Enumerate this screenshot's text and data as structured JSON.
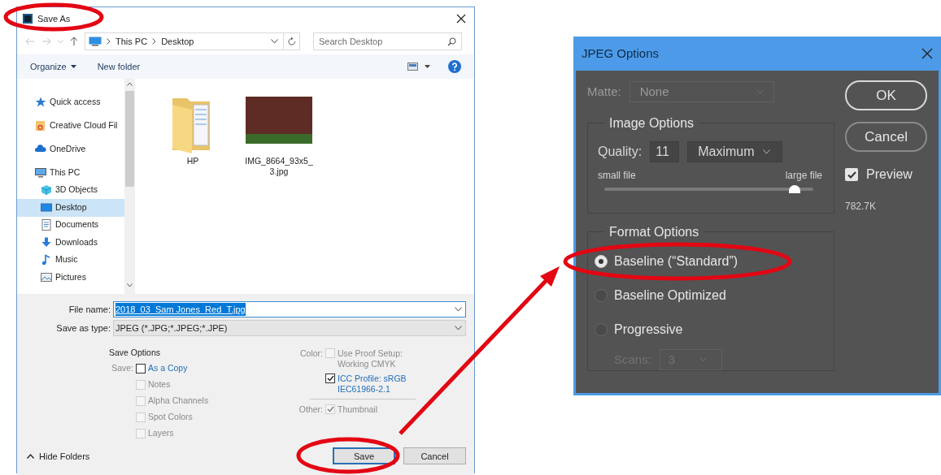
{
  "save_dialog": {
    "title": "Save As",
    "address": {
      "path": [
        "This PC",
        "Desktop"
      ]
    },
    "search": {
      "placeholder": "Search Desktop"
    },
    "toolbar": {
      "organize": "Organize",
      "new_folder": "New folder"
    },
    "sidebar": {
      "items": [
        {
          "label": "Quick access",
          "selected": false
        },
        {
          "label": "Creative Cloud Fil",
          "selected": false
        },
        {
          "label": "OneDrive",
          "selected": false
        },
        {
          "label": "This PC",
          "selected": false,
          "children": [
            {
              "label": "3D Objects",
              "selected": false
            },
            {
              "label": "Desktop",
              "selected": true
            },
            {
              "label": "Documents",
              "selected": false
            },
            {
              "label": "Downloads",
              "selected": false
            },
            {
              "label": "Music",
              "selected": false
            },
            {
              "label": "Pictures",
              "selected": false
            }
          ]
        }
      ]
    },
    "files": [
      {
        "kind": "folder",
        "name": "HP"
      },
      {
        "kind": "image",
        "name": "IMG_8664_93x5_3.jpg"
      }
    ],
    "file_name": {
      "label": "File name:",
      "value": "2018_03_Sam Jones_Red_T.jpg"
    },
    "save_as_type": {
      "label": "Save as type:",
      "value": "JPEG (*.JPG;*.JPEG;*.JPE)"
    },
    "save_options": {
      "title": "Save Options",
      "label": "Save:",
      "items": [
        {
          "label": "As a Copy",
          "checked": false,
          "disabled": false
        },
        {
          "label": "Notes",
          "checked": false,
          "disabled": true
        },
        {
          "label": "Alpha Channels",
          "checked": false,
          "disabled": true
        },
        {
          "label": "Spot Colors",
          "checked": false,
          "disabled": true
        },
        {
          "label": "Layers",
          "checked": false,
          "disabled": true
        }
      ]
    },
    "color_options": {
      "label": "Color:",
      "items": [
        {
          "label": "Use Proof Setup: Working CMYK",
          "checked": false,
          "disabled": true
        },
        {
          "label": "ICC Profile:  sRGB IEC61966-2.1",
          "checked": true,
          "disabled": false
        }
      ]
    },
    "other_options": {
      "label": "Other:",
      "items": [
        {
          "label": "Thumbnail",
          "checked": true,
          "disabled": true
        }
      ]
    },
    "hide_folders": "Hide Folders",
    "buttons": [
      {
        "label": "Save",
        "default": true
      },
      {
        "label": "Cancel",
        "default": false
      }
    ]
  },
  "jpeg_dialog": {
    "title": "JPEG Options",
    "matte": {
      "label": "Matte:",
      "value": "None",
      "disabled": true
    },
    "image_options": {
      "title": "Image Options",
      "quality_label": "Quality:",
      "quality": "11",
      "quality_preset": "Maximum",
      "small_label": "small file",
      "large_label": "large file",
      "level": 0.91
    },
    "format_options": {
      "title": "Format Options",
      "items": [
        {
          "label": "Baseline (“Standard”)",
          "selected": true
        },
        {
          "label": "Baseline Optimized",
          "selected": false
        },
        {
          "label": "Progressive",
          "selected": false
        }
      ],
      "scans": {
        "label": "Scans:",
        "value": "3",
        "disabled": true
      }
    },
    "buttons": [
      {
        "label": "OK"
      },
      {
        "label": "Cancel"
      }
    ],
    "preview": {
      "label": "Preview",
      "checked": true
    },
    "file_size": "782.7K"
  }
}
